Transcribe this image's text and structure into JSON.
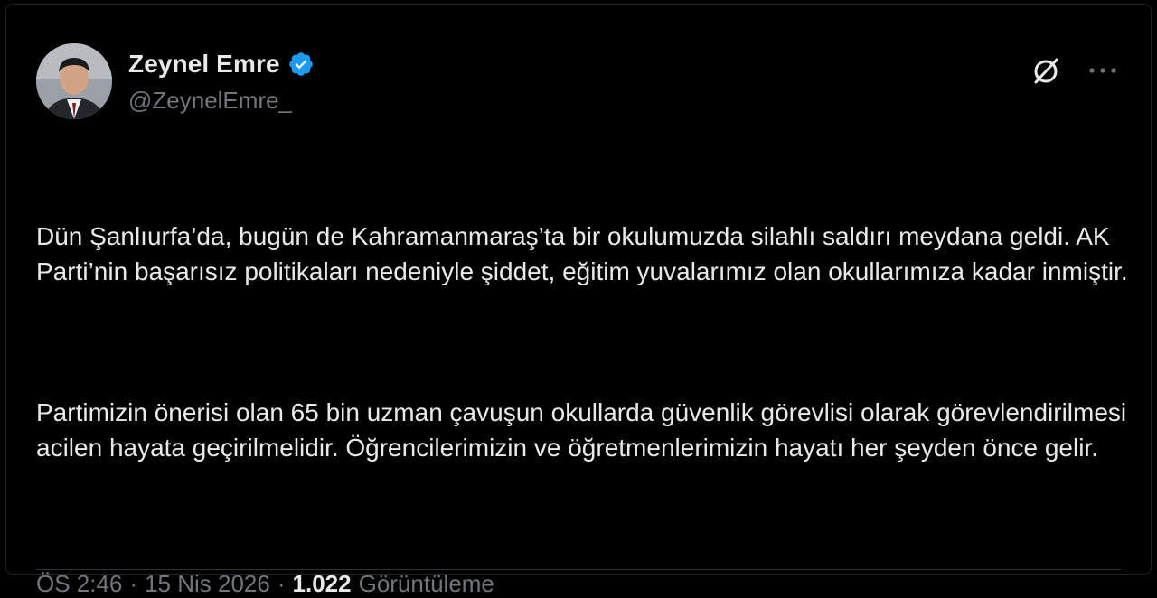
{
  "tweet": {
    "author": {
      "display_name": "Zeynel Emre",
      "handle": "@ZeynelEmre_",
      "verified": true,
      "verified_color": "#1d9bf0"
    },
    "paragraphs": [
      "Dün Şanlıurfa’da, bugün de Kahramanmaraş’ta bir okulumuzda silahlı saldırı meydana geldi. AK Parti’nin başarısız politikaları nedeniyle şiddet, eğitim yuvalarımız olan okullarımıza kadar inmiştir.",
      "Partimizin önerisi olan 65 bin uzman çavuşun okullarda güvenlik görevlisi olarak görevlendirilmesi acilen hayata geçirilmelidir. Öğrencilerimizin ve öğretmenlerimizin hayatı her şeyden önce gelir."
    ],
    "meta": {
      "time": "ÖS 2:46",
      "date": "15 Nis 2026",
      "separator": "·",
      "views_count": "1.022",
      "views_label": "Görüntüleme"
    },
    "icons": {
      "grok": "grok-icon",
      "more": "more-icon"
    }
  },
  "colors": {
    "background": "#000000",
    "text_primary": "#e7e9ea",
    "text_secondary": "#71767b",
    "accent": "#1d9bf0"
  }
}
